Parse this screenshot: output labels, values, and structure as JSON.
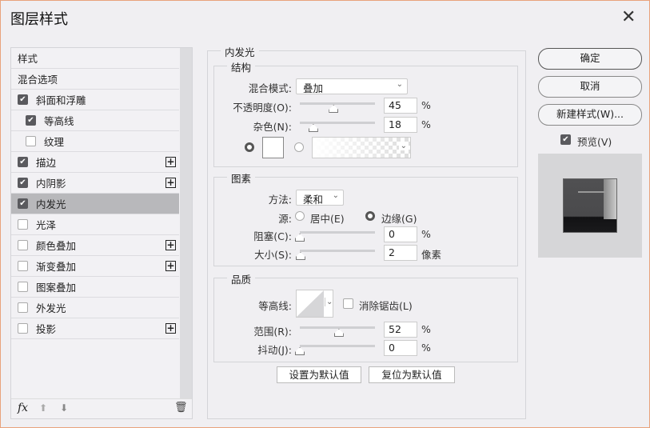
{
  "dialog": {
    "title": "图层样式",
    "close": "✕"
  },
  "styles_list": [
    {
      "label": "样式",
      "checkbox": null,
      "plus": false,
      "indent": 0
    },
    {
      "label": "混合选项",
      "checkbox": null,
      "plus": false,
      "indent": 0
    },
    {
      "label": "斜面和浮雕",
      "checkbox": true,
      "plus": false,
      "indent": 0
    },
    {
      "label": "等高线",
      "checkbox": true,
      "plus": false,
      "indent": 1
    },
    {
      "label": "纹理",
      "checkbox": false,
      "plus": false,
      "indent": 1
    },
    {
      "label": "描边",
      "checkbox": true,
      "plus": true,
      "indent": 0
    },
    {
      "label": "内阴影",
      "checkbox": true,
      "plus": true,
      "indent": 0
    },
    {
      "label": "内发光",
      "checkbox": true,
      "plus": false,
      "indent": 0,
      "selected": true
    },
    {
      "label": "光泽",
      "checkbox": false,
      "plus": false,
      "indent": 0
    },
    {
      "label": "颜色叠加",
      "checkbox": false,
      "plus": true,
      "indent": 0
    },
    {
      "label": "渐变叠加",
      "checkbox": false,
      "plus": true,
      "indent": 0
    },
    {
      "label": "图案叠加",
      "checkbox": false,
      "plus": false,
      "indent": 0
    },
    {
      "label": "外发光",
      "checkbox": false,
      "plus": false,
      "indent": 0
    },
    {
      "label": "投影",
      "checkbox": false,
      "plus": true,
      "indent": 0
    }
  ],
  "list_toolbar": {
    "fx": "fx"
  },
  "panel": {
    "title": "内发光",
    "structure": {
      "title": "结构",
      "blend_label": "混合模式:",
      "blend_value": "叠加",
      "opacity_label": "不透明度(O):",
      "opacity": "45",
      "opacity_frac": 0.45,
      "opacity_unit": "%",
      "noise_label": "杂色(N):",
      "noise": "18",
      "noise_frac": 0.18,
      "noise_unit": "%",
      "solid_selected": true
    },
    "elements": {
      "title": "图素",
      "method_label": "方法:",
      "method_value": "柔和",
      "source_label": "源:",
      "center": "居中(E)",
      "edge": "边缘(G)",
      "edge_selected": true,
      "choke_label": "阻塞(C):",
      "choke": "0",
      "choke_frac": 0,
      "choke_unit": "%",
      "size_label": "大小(S):",
      "size": "2",
      "size_frac": 0.01,
      "size_unit": "像素"
    },
    "quality": {
      "title": "品质",
      "contour_label": "等高线:",
      "antialias": "消除锯齿(L)",
      "antialias_checked": false,
      "range_label": "范围(R):",
      "range": "52",
      "range_frac": 0.52,
      "range_unit": "%",
      "jitter_label": "抖动(J):",
      "jitter": "0",
      "jitter_frac": 0,
      "jitter_unit": "%"
    },
    "make_default": "设置为默认值",
    "reset_default": "复位为默认值"
  },
  "actions": {
    "ok": "确定",
    "cancel": "取消",
    "new_style": "新建样式(W)...",
    "preview": "预览(V)",
    "preview_checked": true
  }
}
